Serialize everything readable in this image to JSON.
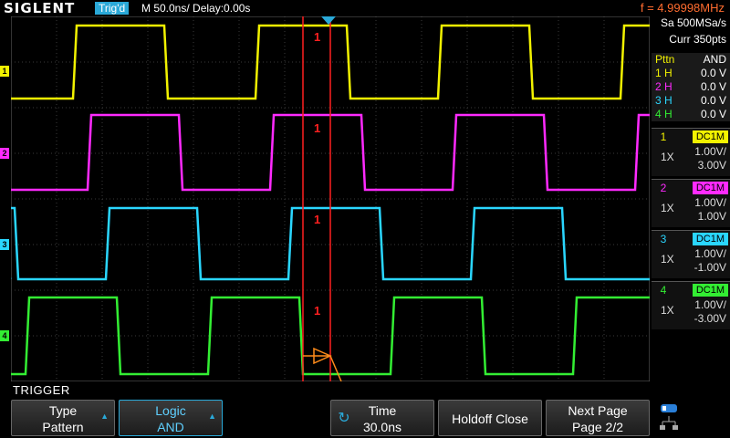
{
  "header": {
    "brand": "SIGLENT",
    "status": "Trig'd",
    "timebase": "M 50.0ns/",
    "delay": "Delay:0.00s",
    "frequency": "f = 4.99998MHz"
  },
  "acquisition": {
    "sample_rate": "Sa 500MSa/s",
    "memory": "Curr 350pts"
  },
  "pattern": {
    "header_label": "Pttn",
    "header_value": "AND",
    "rows": [
      {
        "label": "1 H",
        "value": "0.0 V",
        "color": "#f2f200"
      },
      {
        "label": "2 H",
        "value": "0.0 V",
        "color": "#ff2aff"
      },
      {
        "label": "3 H",
        "value": "0.0 V",
        "color": "#2ad6ff"
      },
      {
        "label": "4 H",
        "value": "0.0 V",
        "color": "#33ee33"
      }
    ]
  },
  "channels": [
    {
      "num": "1",
      "coupling": "DC1M",
      "probe": "1X",
      "scale": "1.00V/",
      "offset": "3.00V",
      "color": "#f2f200"
    },
    {
      "num": "2",
      "coupling": "DC1M",
      "probe": "1X",
      "scale": "1.00V/",
      "offset": "1.00V",
      "color": "#ff2aff"
    },
    {
      "num": "3",
      "coupling": "DC1M",
      "probe": "1X",
      "scale": "1.00V/",
      "offset": "-1.00V",
      "color": "#2ad6ff"
    },
    {
      "num": "4",
      "coupling": "DC1M",
      "probe": "1X",
      "scale": "1.00V/",
      "offset": "-3.00V",
      "color": "#33ee33"
    }
  ],
  "cursor_labels": [
    "1",
    "1",
    "1",
    "1"
  ],
  "menu": {
    "title": "TRIGGER",
    "softkeys": [
      {
        "line1": "Type",
        "line2": "Pattern"
      },
      {
        "line1": "Logic",
        "line2": "AND"
      },
      {
        "line1": "Time",
        "line2": "30.0ns"
      },
      {
        "line1": "Holdoff Close",
        "line2": ""
      },
      {
        "line1": "Next Page",
        "line2": "Page 2/2"
      }
    ]
  },
  "colors": {
    "cursor": "#ff2020",
    "trigger_marker": "#2aa9d8",
    "accent_orange": "#ff8c1a"
  }
}
